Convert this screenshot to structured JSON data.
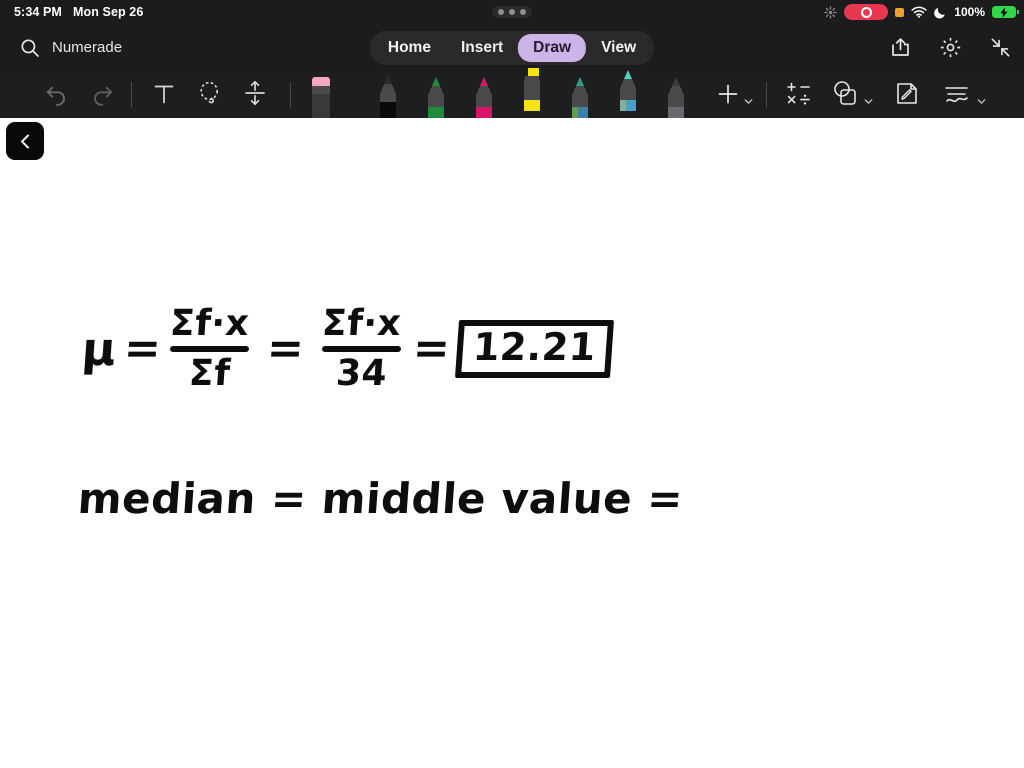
{
  "status_bar": {
    "time": "5:34 PM",
    "date": "Mon Sep 26",
    "icons": [
      "screen-mirroring-icon",
      "recording-indicator",
      "microphone-in-use-icon",
      "wifi-icon",
      "do-not-disturb-moon-icon"
    ],
    "battery_percent": "100%",
    "battery_state": "charging"
  },
  "title_bar": {
    "search_icon": "search-icon",
    "document_title": "Numerade",
    "tabs": [
      {
        "label": "Home",
        "active": false
      },
      {
        "label": "Insert",
        "active": false
      },
      {
        "label": "Draw",
        "active": true
      },
      {
        "label": "View",
        "active": false
      }
    ],
    "right_actions": [
      {
        "name": "share-icon",
        "label": "Share"
      },
      {
        "name": "gear-icon",
        "label": "Settings"
      },
      {
        "name": "collapse-icon",
        "label": "Collapse ribbon"
      }
    ],
    "active_tab_color": "#ccb3e8"
  },
  "ribbon": {
    "undo": {
      "name": "undo-icon",
      "enabled": false
    },
    "redo": {
      "name": "redo-icon",
      "enabled": false
    },
    "text_tool": {
      "name": "text-tool-icon",
      "label": "T"
    },
    "lasso_tool": {
      "name": "lasso-select-icon"
    },
    "insert_space_tool": {
      "name": "insert-space-icon"
    },
    "pens": [
      {
        "name": "eraser-tool",
        "color": "#f2a8bd",
        "selected": false
      },
      {
        "name": "pen-tool-black",
        "color": "#0a0a0a",
        "selected": false
      },
      {
        "name": "pen-tool-green",
        "color": "#1f8a3c",
        "selected": false
      },
      {
        "name": "pen-tool-pink",
        "color": "#d6156b",
        "selected": false
      },
      {
        "name": "highlighter-tool-yellow",
        "color": "#f5e315",
        "selected": true
      },
      {
        "name": "pen-tool-teal",
        "color": "#2f9e8f",
        "selected": false
      },
      {
        "name": "pen-tool-cyan",
        "color": "#4fd0c4",
        "selected": true
      },
      {
        "name": "pen-tool-gray",
        "color": "#8e8e93",
        "selected": false
      }
    ],
    "add_pen": {
      "name": "add-pen-icon",
      "label": "+"
    },
    "math_tool": {
      "name": "math-symbols-icon",
      "label": "+−×÷"
    },
    "shapes_tool": {
      "name": "shapes-icon"
    },
    "note_tool": {
      "name": "sticky-note-edit-icon"
    },
    "ink_effects_tool": {
      "name": "ink-squiggle-icon"
    }
  },
  "canvas": {
    "back_button": {
      "name": "back-chevron-button",
      "glyph": "‹"
    },
    "background_color": "#ffffff",
    "handwriting": {
      "line1": {
        "mu": "μ",
        "eq1": "=",
        "frac1_num": "Σf·x",
        "frac1_den": "Σf",
        "eq2": "=",
        "frac2_num": "Σf·x",
        "frac2_den": "34",
        "eq3": "=",
        "boxed_result": "12.21"
      },
      "line2": "median = middle value ="
    }
  }
}
